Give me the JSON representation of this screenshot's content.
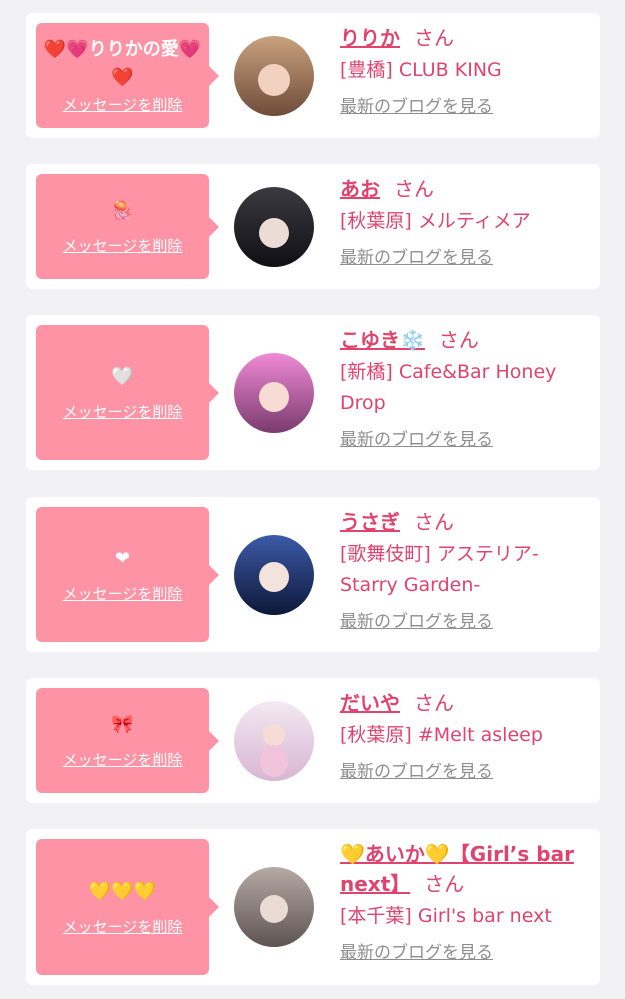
{
  "cards": [
    {
      "message": "❤️💗りりかの愛💗❤️",
      "delete_label": "メッセージを削除",
      "name": "りりか",
      "honorific": "さん",
      "shop": "[豊橋] CLUB KING",
      "blog_link": "最新のブログを見る",
      "avatar_colors": [
        "#c9a27e",
        "#6f4b3a"
      ]
    },
    {
      "message": "🪼",
      "delete_label": "メッセージを削除",
      "name": "あお",
      "honorific": "さん",
      "shop": "[秋葉原] メルティメア",
      "blog_link": "最新のブログを見る",
      "avatar_colors": [
        "#3a3a40",
        "#0f0f14"
      ]
    },
    {
      "message": "🤍",
      "delete_label": "メッセージを削除",
      "name": "こゆき❄️",
      "honorific": "さん",
      "shop": "[新橋] Cafe&Bar Honey Drop",
      "blog_link": "最新のブログを見る",
      "avatar_colors": [
        "#f08ad6",
        "#7a3b6e"
      ]
    },
    {
      "message": "❤",
      "delete_label": "メッセージを削除",
      "name": "うさぎ",
      "honorific": "さん",
      "shop": "[歌舞伎町] アステリア-Starry Garden-",
      "blog_link": "最新のブログを見る",
      "avatar_colors": [
        "#3c5aa8",
        "#0d1838"
      ]
    },
    {
      "message": "🎀",
      "delete_label": "メッセージを削除",
      "name": "だいや",
      "honorific": "さん",
      "shop": "[秋葉原] #Melt asleep",
      "blog_link": "最新のブログを見る",
      "avatar_colors": [
        "#f3e9f4",
        "#d8b6d2"
      ]
    },
    {
      "message": "💛💛💛",
      "delete_label": "メッセージを削除",
      "name": "💛あいか💛【Girl’s bar next】",
      "honorific": "さん",
      "shop": "[本千葉] Girl's bar next",
      "blog_link": "最新のブログを見る",
      "avatar_colors": [
        "#b5aaa6",
        "#5d5350"
      ]
    }
  ]
}
